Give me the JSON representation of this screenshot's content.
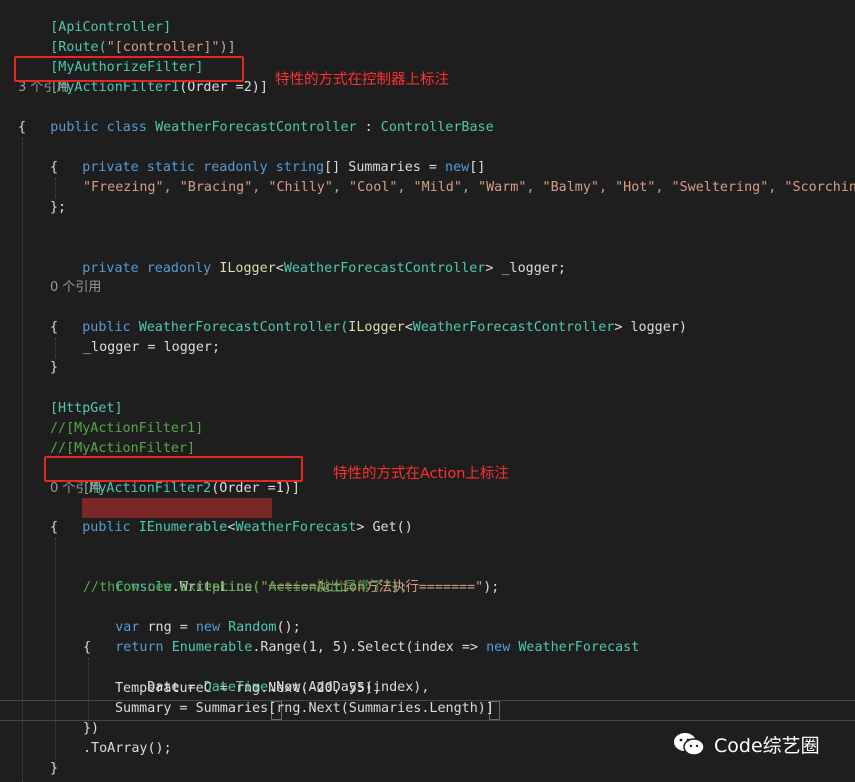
{
  "editor": {
    "lines": {
      "l1": "[ApiController]",
      "l2_a": "[Route(",
      "l2_b": "\"[controller]\"",
      "l2_c": ")]",
      "l3": "[MyAuthorizeFilter]",
      "l4_a": "[MyActionFilter1",
      "l4_b": "(Order =2)]",
      "lens1": "3 个引用",
      "l5_a": "public class ",
      "l5_b": "WeatherForecastController",
      "l5_c": " : ",
      "l5_d": "ControllerBase",
      "l6": "{",
      "l7_a": "private static readonly string",
      "l7_b": "[] Summaries = ",
      "l7_c": "new",
      "l7_d": "[]",
      "l8": "{",
      "l9": "\"Freezing\", \"Bracing\", \"Chilly\", \"Cool\", \"Mild\", \"Warm\", \"Balmy\", \"Hot\", \"Sweltering\", \"Scorching\"",
      "l10": "};",
      "l11_a": "private readonly ",
      "l11_b": "ILogger",
      "l11_c": "<",
      "l11_d": "WeatherForecastController",
      "l11_e": "> _logger;",
      "lens2": "0 个引用",
      "l12_a": "public ",
      "l12_b": "WeatherForecastController(",
      "l12_c": "ILogger",
      "l12_d": "<",
      "l12_e": "WeatherForecastController",
      "l12_f": "> logger)",
      "l13": "{",
      "l14": "_logger = logger;",
      "l15": "}",
      "l16": "[HttpGet]",
      "l17": "//[MyActionFilter1]",
      "l18": "//[MyActionFilter]",
      "l19_a": "[MyActionFilter2",
      "l19_b": "(Order =1)]",
      "lens3": "0 个引用",
      "l20_a": "public ",
      "l20_b": "IEnumerable",
      "l20_c": "<",
      "l20_d": "WeatherForecast",
      "l20_e": "> Get()",
      "l21": "{",
      "l22_a": "Console",
      "l22_b": ".WriteLine(",
      "l22_c": "\"======Action方法执行=======\"",
      "l22_d": ");",
      "l23": "//throw new Exception(\"Action抛出异常了\");",
      "l24_a": "var",
      "l24_b": " rng = ",
      "l24_c": "new ",
      "l24_d": "Random",
      "l24_e": "();",
      "l25_a": "return ",
      "l25_b": "Enumerable",
      "l25_c": ".Range(1, 5).Select(index => ",
      "l25_d": "new ",
      "l25_e": "WeatherForecast",
      "l26": "{",
      "l27_a": "Date = ",
      "l27_b": "DateTime",
      "l27_c": ".Now.AddDays(index),",
      "l28": "TemperatureC = rng.Next(-20, 55),",
      "l29": "Summary = Summaries[rng.Next(Summaries.Length)]",
      "l30": "})",
      "l31": ".ToArray();",
      "l32": "}"
    }
  },
  "annotations": {
    "controller_note": "特性的方式在控制器上标注",
    "action_note": "特性的方式在Action上标注",
    "color": "#e8251e"
  },
  "watermark": {
    "text": "Code综艺圈",
    "icon": "wechat-icon"
  }
}
